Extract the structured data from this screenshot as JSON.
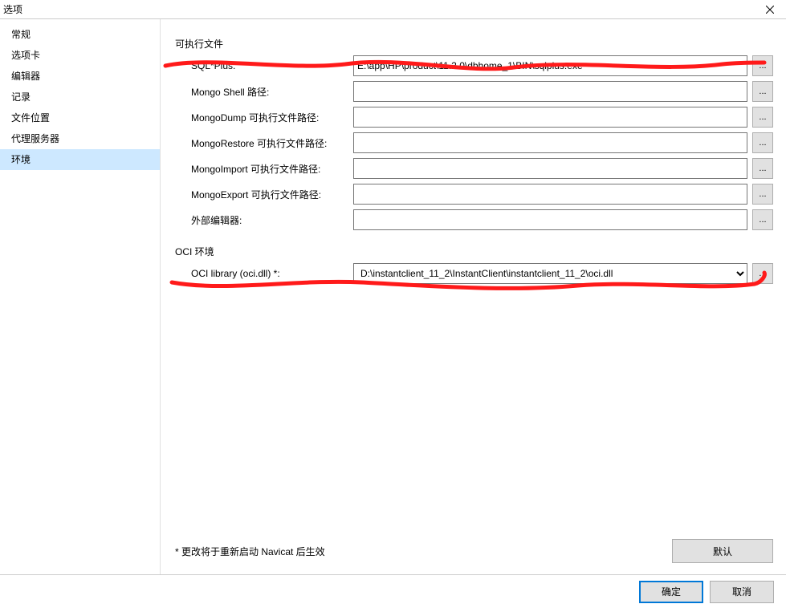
{
  "window": {
    "title": "选项"
  },
  "sidebar": {
    "items": [
      {
        "label": "常规"
      },
      {
        "label": "选项卡"
      },
      {
        "label": "编辑器"
      },
      {
        "label": "记录"
      },
      {
        "label": "文件位置"
      },
      {
        "label": "代理服务器"
      },
      {
        "label": "环境"
      }
    ],
    "selected_index": 6
  },
  "sections": {
    "executables": {
      "title": "可执行文件",
      "rows": [
        {
          "label": "SQL*Plus:",
          "value": "E:\\app\\HP\\product\\11.2.0\\dbhome_1\\BIN\\sqlplus.exe",
          "browse": "..."
        },
        {
          "label": "Mongo Shell 路径:",
          "value": "",
          "browse": "..."
        },
        {
          "label": "MongoDump 可执行文件路径:",
          "value": "",
          "browse": "..."
        },
        {
          "label": "MongoRestore 可执行文件路径:",
          "value": "",
          "browse": "..."
        },
        {
          "label": "MongoImport 可执行文件路径:",
          "value": "",
          "browse": "..."
        },
        {
          "label": "MongoExport 可执行文件路径:",
          "value": "",
          "browse": "..."
        },
        {
          "label": "外部编辑器:",
          "value": "",
          "browse": "..."
        }
      ]
    },
    "oci": {
      "title": "OCI 环境",
      "rows": [
        {
          "label": "OCI library (oci.dll) *:",
          "value": "D:\\instantclient_11_2\\InstantClient\\instantclient_11_2\\oci.dll",
          "browse": "..."
        }
      ]
    }
  },
  "footer": {
    "restart_note": "* 更改将于重新启动 Navicat 后生效",
    "default_btn": "默认",
    "ok_btn": "确定",
    "cancel_btn": "取消"
  },
  "annotation_color": "#ff1a1a"
}
